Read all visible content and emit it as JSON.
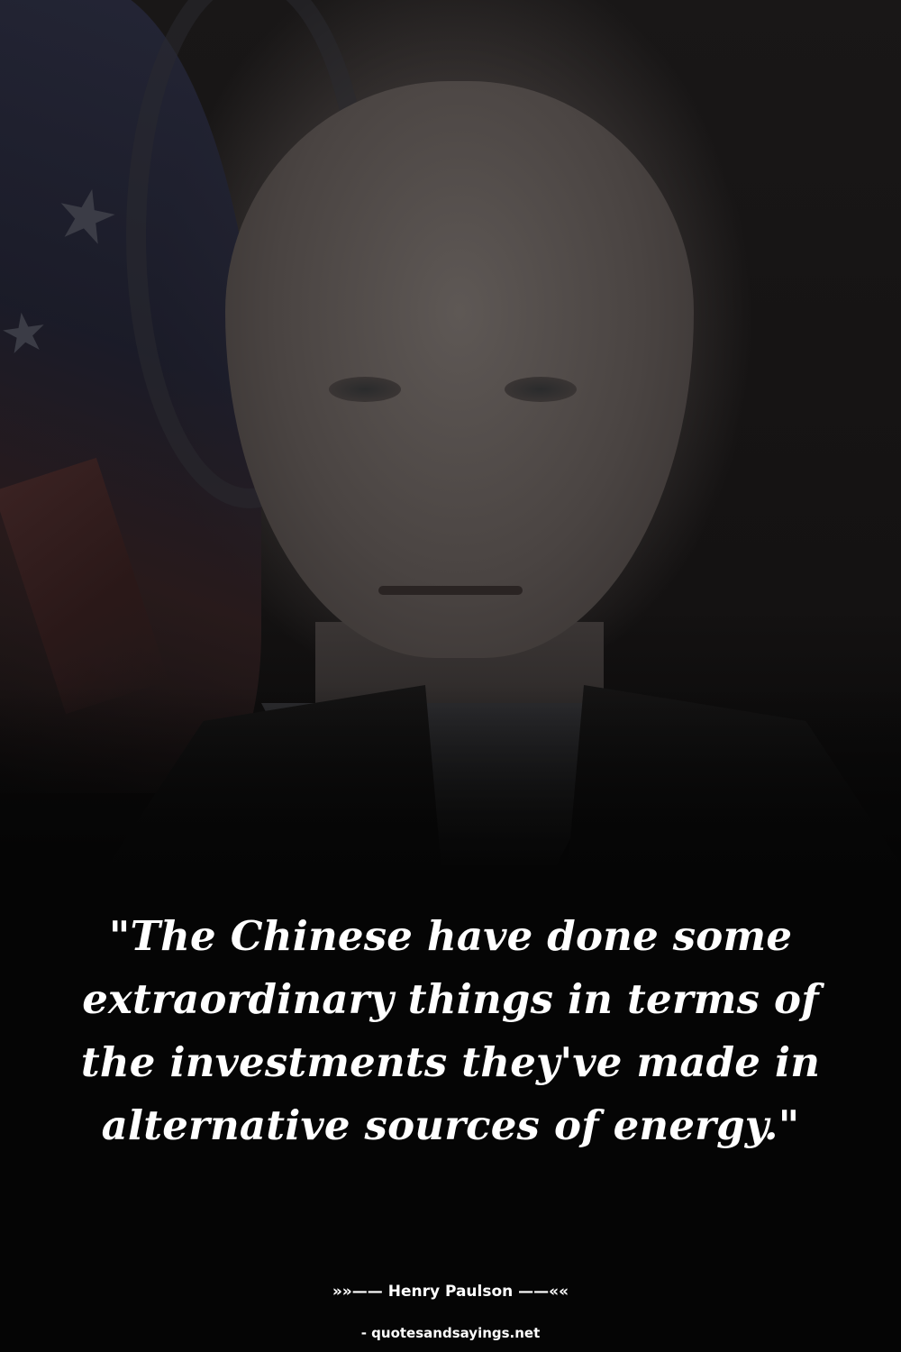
{
  "quote": {
    "text": "\"The Chinese have done some extraordinary things in terms of the investments they've made in alternative sources of energy.\""
  },
  "author": {
    "name": "»»—— Henry Paulson ——««"
  },
  "source": {
    "site": "- quotesandsayings.net"
  },
  "colors": {
    "background": "#050505",
    "text": "#ffffff"
  }
}
